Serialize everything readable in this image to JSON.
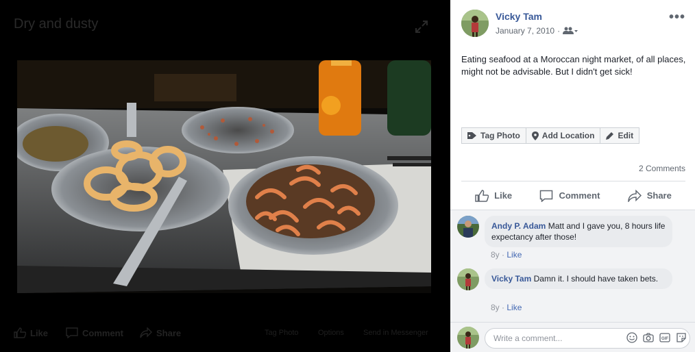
{
  "viewer": {
    "album_title": "Dry and dusty",
    "actions": {
      "like": "Like",
      "comment": "Comment",
      "share": "Share"
    },
    "links": {
      "tag_photo": "Tag Photo",
      "options": "Options",
      "send_in_messenger": "Send in Messenger"
    }
  },
  "post": {
    "author": "Vicky Tam",
    "date": "January 7, 2010",
    "caption": "Eating seafood at a Moroccan night market, of all places, might not be advisable. But I didn't get sick!",
    "tag_buttons": {
      "tag_photo": "Tag Photo",
      "add_location": "Add Location",
      "edit": "Edit"
    },
    "comments_count": "2 Comments",
    "actions": {
      "like": "Like",
      "comment": "Comment",
      "share": "Share"
    }
  },
  "comments": [
    {
      "author": "Andy P. Adam",
      "text": "Matt and I gave you, 8 hours life expectancy after those!",
      "age": "8y",
      "like_label": "Like"
    },
    {
      "author": "Vicky Tam",
      "text": "Damn it. I should have taken bets.",
      "age": "8y",
      "like_label": "Like"
    }
  ],
  "composer": {
    "placeholder": "Write a comment..."
  },
  "colors": {
    "link_blue": "#385898",
    "like_blue": "#4267b2",
    "muted_text": "#606770"
  }
}
